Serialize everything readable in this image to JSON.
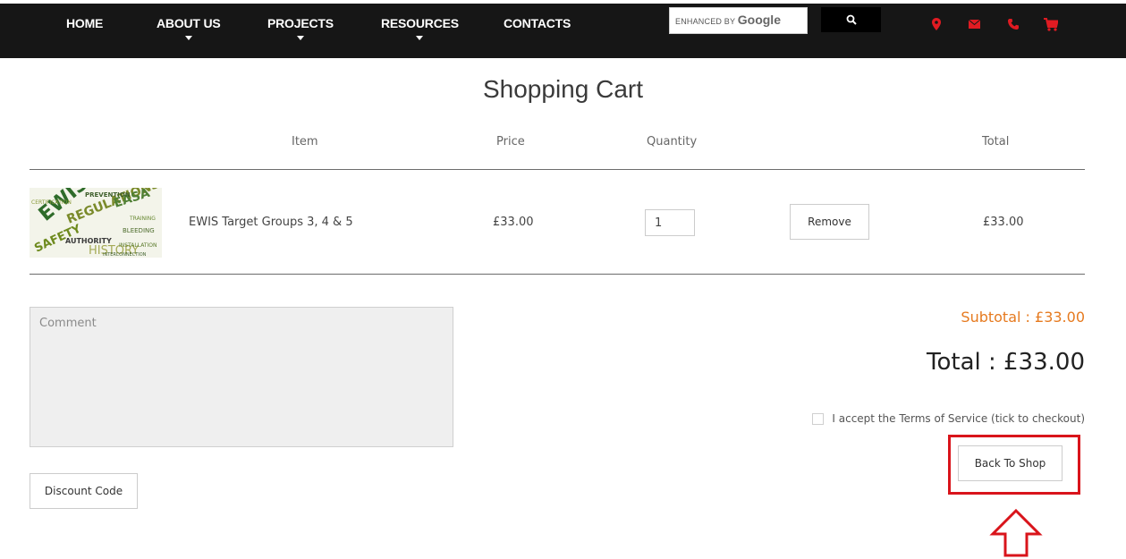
{
  "nav": {
    "items": [
      {
        "label": "HOME",
        "has_dropdown": false
      },
      {
        "label": "ABOUT US",
        "has_dropdown": true
      },
      {
        "label": "PROJECTS",
        "has_dropdown": true
      },
      {
        "label": "RESOURCES",
        "has_dropdown": true
      },
      {
        "label": "CONTACTS",
        "has_dropdown": false
      }
    ],
    "search": {
      "prefix": "ENHANCED BY",
      "brand": "Google",
      "button_icon": "search-icon"
    },
    "icons": [
      "map-pin-icon",
      "envelope-icon",
      "phone-icon",
      "cart-icon"
    ],
    "icon_color": "#e01b22"
  },
  "page": {
    "title": "Shopping Cart"
  },
  "cart": {
    "columns": {
      "item": "Item",
      "price": "Price",
      "quantity": "Quantity",
      "total": "Total"
    },
    "rows": [
      {
        "thumbnail_alt": "word cloud image",
        "name": "EWIS Target Groups 3, 4 & 5",
        "price": "£33.00",
        "quantity": "1",
        "remove_label": "Remove",
        "total": "£33.00"
      }
    ]
  },
  "summary": {
    "comment_placeholder": "Comment",
    "discount_label": "Discount Code",
    "subtotal": "Subtotal : £33.00",
    "total": "Total : £33.00",
    "terms_label": "I accept the Terms of Service (tick to checkout)",
    "back_label": "Back To Shop"
  },
  "colors": {
    "nav_bg": "#161616",
    "accent_orange": "#e67a1f",
    "annotation_red": "#d9141b"
  }
}
